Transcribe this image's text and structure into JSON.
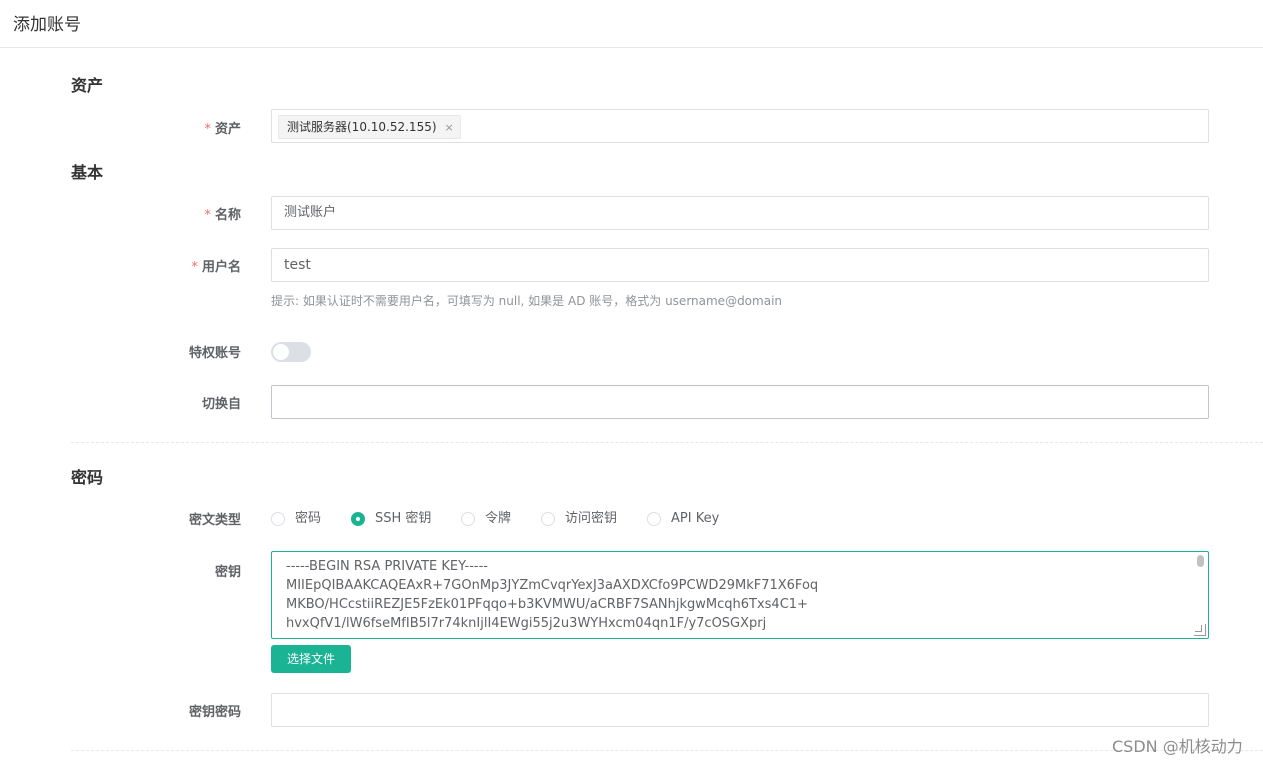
{
  "header": {
    "title": "添加账号"
  },
  "sections": {
    "asset": "资产",
    "basic": "基本",
    "password": "密码"
  },
  "fields": {
    "asset": {
      "label": "资产",
      "required": "*",
      "tag": "测试服务器(10.10.52.155)",
      "tag_close": "×"
    },
    "name": {
      "label": "名称",
      "required": "*",
      "value": "测试账户"
    },
    "username": {
      "label": "用户名",
      "required": "*",
      "value": "test",
      "hint": "提示: 如果认证时不需要用户名，可填写为 null, 如果是 AD 账号，格式为 username@domain"
    },
    "privileged": {
      "label": "特权账号",
      "checked": false
    },
    "su_from": {
      "label": "切换自",
      "value": ""
    },
    "secret_type": {
      "label": "密文类型",
      "options": [
        "密码",
        "SSH 密钥",
        "令牌",
        "访问密钥",
        "API Key"
      ],
      "selected": "SSH 密钥"
    },
    "key": {
      "label": "密钥",
      "lines": [
        "-----BEGIN RSA PRIVATE KEY-----",
        "MIIEpQIBAAKCAQEAxR+7GOnMp3JYZmCvqrYexJ3aAXDXCfo9PCWD29MkF71X6Foq",
        "MKBO/HCcstiiREZJE5FzEk01PFqqo+b3KVMWU/aCRBF7SANhjkgwMcqh6Txs4C1+",
        "hvxQfV1/lW6fseMfIB5l7r74knIjlI4EWgi55j2u3WYHxcm04qn1F/y7cOSGXprj"
      ],
      "file_button": "选择文件"
    },
    "key_password": {
      "label": "密钥密码",
      "value": ""
    }
  },
  "watermark": "CSDN @机核动力",
  "colors": {
    "accent": "#1ab394",
    "required": "#f56c6c"
  }
}
